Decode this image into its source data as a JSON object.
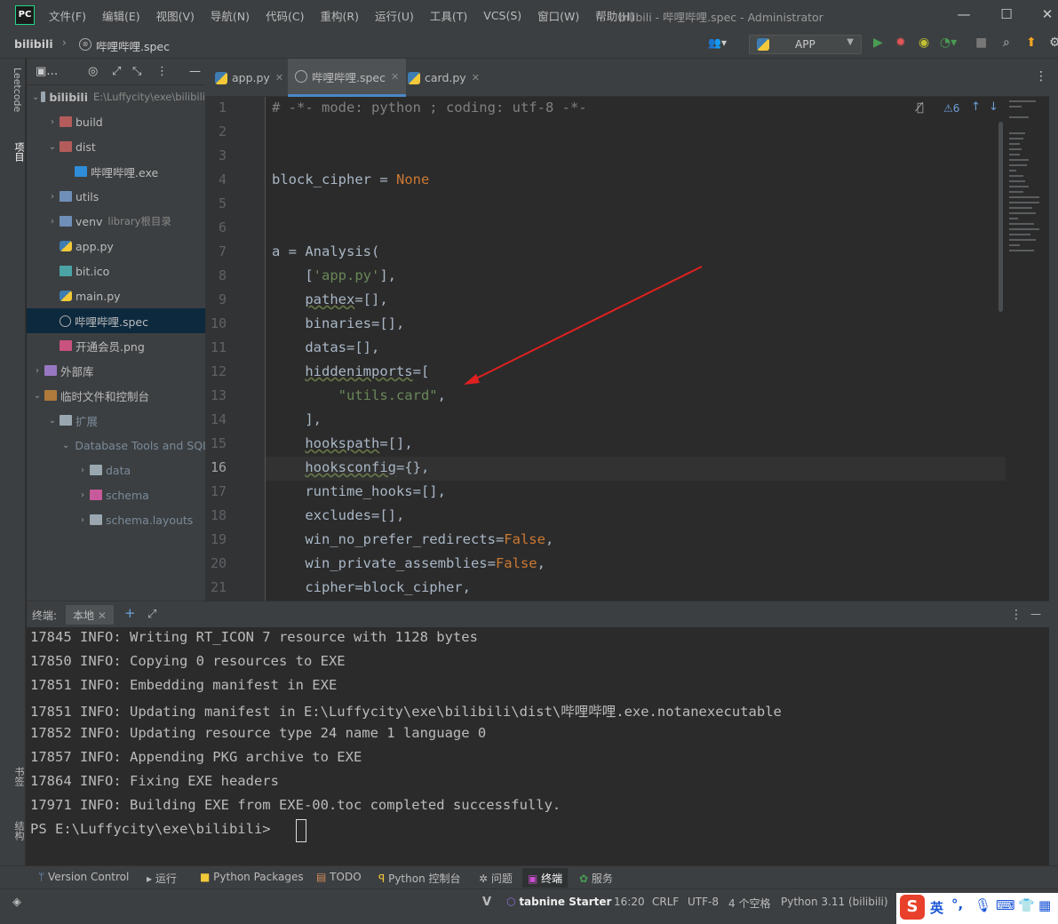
{
  "app": {
    "logo": "PC",
    "window_title": "bilibili - 哔哩哔哩.spec - Administrator",
    "menu": [
      "文件(F)",
      "编辑(E)",
      "视图(V)",
      "导航(N)",
      "代码(C)",
      "重构(R)",
      "运行(U)",
      "工具(T)",
      "VCS(S)",
      "窗口(W)",
      "帮助(H)"
    ],
    "win_min": "—",
    "win_max": "☐",
    "win_close": "✕"
  },
  "nav": {
    "project": "bilibili",
    "sep": "›",
    "file": "哔哩哔哩.spec",
    "run_config": "APP",
    "colors": {
      "run": "#499c54",
      "debug": "#e05555",
      "update": "#f5a623"
    }
  },
  "side_labels": {
    "leetcode": "Leetcode",
    "project": "项目",
    "bookmarks": "书签",
    "structure": "结构"
  },
  "tree": [
    {
      "depth": 0,
      "arrow": "v",
      "icon": "folder",
      "name": "bilibili",
      "sub": "E:\\Luffycity\\exe\\bilibili"
    },
    {
      "depth": 1,
      "arrow": ">",
      "icon": "folder-red",
      "name": "build"
    },
    {
      "depth": 1,
      "arrow": "v",
      "icon": "folder-red",
      "name": "dist"
    },
    {
      "depth": 2,
      "arrow": "",
      "icon": "win",
      "name": "哔哩哔哩.exe"
    },
    {
      "depth": 1,
      "arrow": ">",
      "icon": "folder-blue",
      "name": "utils"
    },
    {
      "depth": 1,
      "arrow": ">",
      "icon": "folder-blue",
      "name": "venv",
      "sub": "library根目录"
    },
    {
      "depth": 1,
      "arrow": "",
      "icon": "py",
      "name": "app.py"
    },
    {
      "depth": 1,
      "arrow": "",
      "icon": "ico-file",
      "name": "bit.ico"
    },
    {
      "depth": 1,
      "arrow": "",
      "icon": "py",
      "name": "main.py"
    },
    {
      "depth": 1,
      "arrow": "",
      "icon": "spec",
      "name": "哔哩哔哩.spec",
      "selected": true
    },
    {
      "depth": 1,
      "arrow": "",
      "icon": "png",
      "name": "开通会员.png"
    },
    {
      "depth": 0,
      "arrow": ">",
      "icon": "lib",
      "name": "外部库"
    },
    {
      "depth": 0,
      "arrow": "v",
      "icon": "scratch",
      "name": "临时文件和控制台"
    },
    {
      "depth": 1,
      "arrow": "v",
      "icon": "folder",
      "name": "扩展",
      "dim": true
    },
    {
      "depth": 2,
      "arrow": "v",
      "icon": "folder",
      "name": "Database Tools and SQL",
      "dim": true
    },
    {
      "depth": 3,
      "arrow": ">",
      "icon": "folder",
      "name": "data",
      "dim": true
    },
    {
      "depth": 3,
      "arrow": ">",
      "icon": "folder-pink",
      "name": "schema",
      "dim": true
    },
    {
      "depth": 3,
      "arrow": ">",
      "icon": "folder",
      "name": "schema.layouts",
      "dim": true
    }
  ],
  "tabs": [
    {
      "label": "app.py",
      "icon": "py",
      "active": false
    },
    {
      "label": "哔哩哔哩.spec",
      "icon": "spec",
      "active": true
    },
    {
      "label": "card.py",
      "icon": "py",
      "active": false
    }
  ],
  "editor": {
    "current_line": 16,
    "warnings": "6",
    "lines": [
      "# -*- mode: python ; coding: utf-8 -*-",
      "",
      "",
      "block_cipher = None",
      "",
      "",
      "a = Analysis(",
      "    ['app.py'],",
      "    pathex=[],",
      "    binaries=[],",
      "    datas=[],",
      "    hiddenimports=[",
      "        \"utils.card\",",
      "    ],",
      "    hookspath=[],",
      "    hooksconfig={},",
      "    runtime_hooks=[],",
      "    excludes=[],",
      "    win_no_prefer_redirects=False,",
      "    win_private_assemblies=False,",
      "    cipher=block_cipher,"
    ]
  },
  "terminal": {
    "title": "终端:",
    "tab": "本地",
    "lines": [
      "17845 INFO: Writing RT_ICON 7 resource with 1128 bytes",
      "17850 INFO: Copying 0 resources to EXE",
      "17851 INFO: Embedding manifest in EXE",
      "17851 INFO: Updating manifest in E:\\Luffycity\\exe\\bilibili\\dist\\哔哩哔哩.exe.notanexecutable",
      "17852 INFO: Updating resource type 24 name 1 language 0",
      "17857 INFO: Appending PKG archive to EXE",
      "17864 INFO: Fixing EXE headers",
      "17971 INFO: Building EXE from EXE-00.toc completed successfully."
    ],
    "prompt": "PS E:\\Luffycity\\exe\\bilibili>"
  },
  "toolwindows": [
    "Version Control",
    "运行",
    "Python Packages",
    "TODO",
    "Python 控制台",
    "问题",
    "终端",
    "服务"
  ],
  "status": {
    "tabnine": "tabnine Starter",
    "position": "16:20",
    "line_sep": "CRLF",
    "encoding": "UTF-8",
    "indent": "4 个空格",
    "interpreter": "Python 3.11 (bilibili)",
    "project": "bilibili",
    "theme": "Darcula"
  },
  "ime": {
    "lang": "英"
  },
  "annotation_color": "#e02020"
}
